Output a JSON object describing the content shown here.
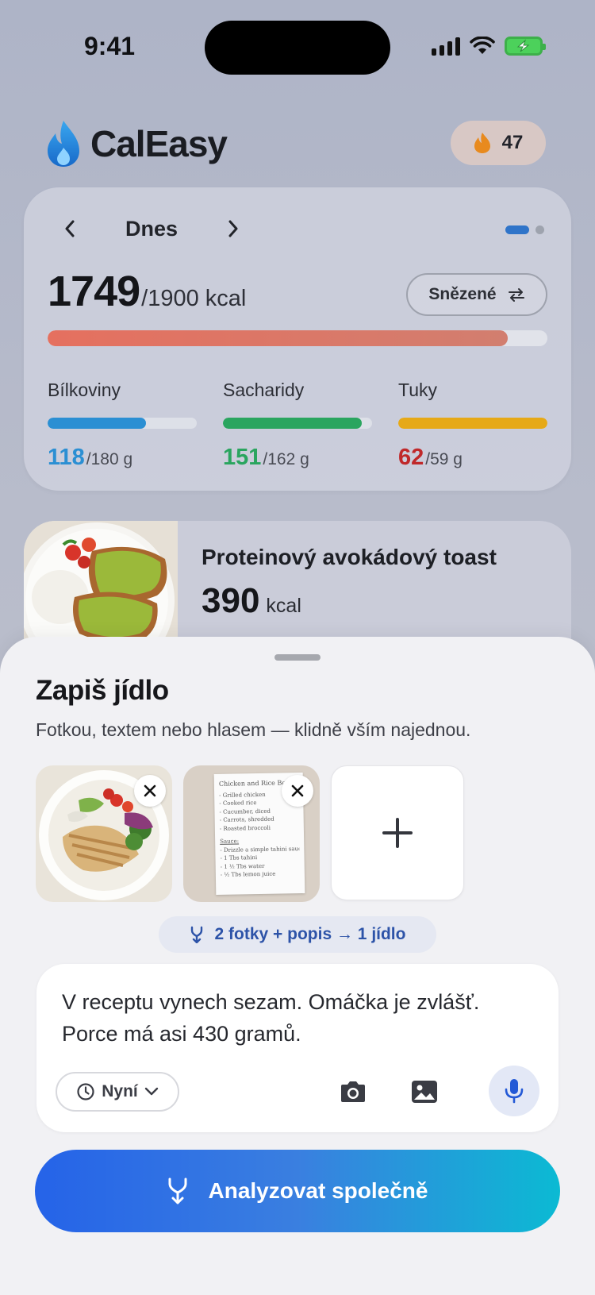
{
  "status_bar": {
    "time": "9:41"
  },
  "header": {
    "app_name": "CalEasy",
    "streak_count": "47"
  },
  "summary": {
    "day_label": "Dnes",
    "kcal_eaten": "1749",
    "kcal_goal": "/1900 kcal",
    "kcal_progress": 0.92,
    "toggle_label": "Snězené",
    "macros": [
      {
        "name": "Bílkoviny",
        "eaten": "118",
        "goal": "/180 g",
        "progress": 0.66,
        "color": "#2b8fd3"
      },
      {
        "name": "Sacharidy",
        "eaten": "151",
        "goal": "/162 g",
        "progress": 0.93,
        "color": "#2aa55f"
      },
      {
        "name": "Tuky",
        "eaten": "62",
        "goal": "/59 g",
        "progress": 1.0,
        "color": "#e6a917"
      }
    ],
    "colors": {
      "kcal_bar": "#e5705f",
      "over_goal_text": "#c0282a"
    }
  },
  "meal": {
    "name": "Proteinový avokádový toast",
    "kcal": "390",
    "kcal_unit": "kcal"
  },
  "sheet": {
    "title": "Zapiš jídlo",
    "subtitle": "Fotkou, textem nebo hlasem — klidně vším najednou.",
    "merge_chip": "2 fotky + popis → 1 jídlo",
    "note_text": "V receptu vynech sezam. Omáčka je zvlášť. Porce má asi 430 gramů.",
    "time_label": "Nyní",
    "analyze_label": "Analyzovat společně",
    "recipe_card": {
      "title": "Chicken and Rice Bowl",
      "lines": [
        "- Grilled chicken",
        "- Cooked rice",
        "- Cucumber, diced",
        "- Carrots, shredded",
        "- Roasted broccoli"
      ],
      "sauce_title": "Sauce:",
      "sauce_lines": [
        "- Drizzle a simple tahini sauce",
        "- 1 Tbs tahini",
        "- 1 ½ Tbs water",
        "- ½ Tbs lemon juice"
      ]
    },
    "colors": {
      "accent": "#2d53a8",
      "button_start": "#2563e8",
      "button_end": "#0bbad3"
    }
  }
}
